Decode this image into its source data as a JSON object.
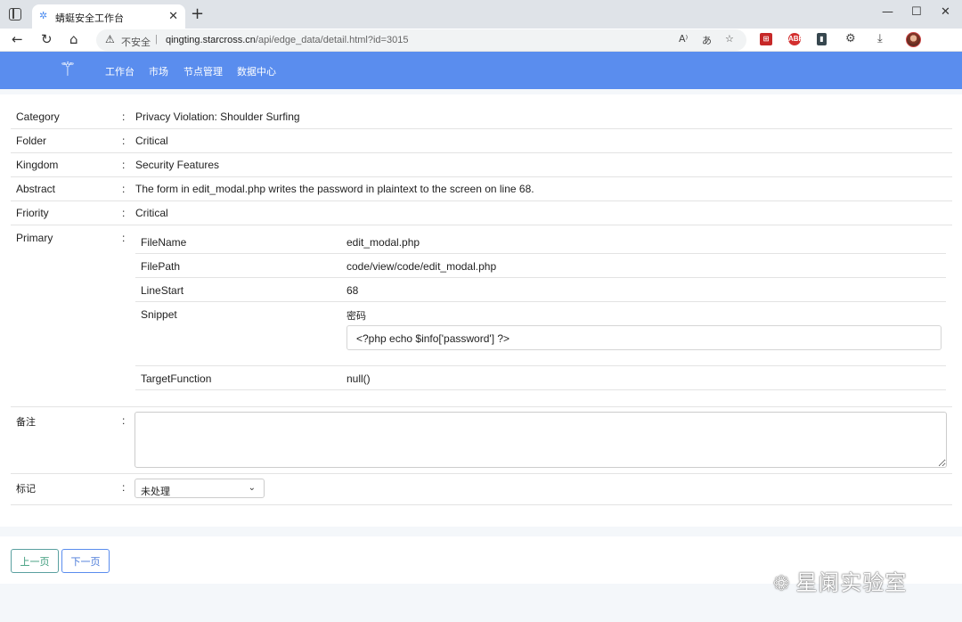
{
  "browser": {
    "tab_title": "蜻蜓安全工作台",
    "insecure_label": "不安全",
    "url_host": "qingting.starcross.cn",
    "url_path": "/api/edge_data/detail.html?id=3015"
  },
  "appnav": {
    "links": [
      "工作台",
      "市场",
      "节点管理",
      "数据中心"
    ]
  },
  "detail": {
    "category": {
      "label": "Category",
      "value": "Privacy Violation: Shoulder Surfing"
    },
    "folder": {
      "label": "Folder",
      "value": "Critical"
    },
    "kingdom": {
      "label": "Kingdom",
      "value": "Security Features"
    },
    "abstract": {
      "label": "Abstract",
      "value": "The form in edit_modal.php writes the password in plaintext to the screen on line 68."
    },
    "friority": {
      "label": "Friority",
      "value": "Critical"
    },
    "primary": {
      "label": "Primary",
      "filename": {
        "label": "FileName",
        "value": "edit_modal.php"
      },
      "filepath": {
        "label": "FilePath",
        "value": "code/view/code/edit_modal.php"
      },
      "linestart": {
        "label": "LineStart",
        "value": "68"
      },
      "snippet": {
        "label": "Snippet",
        "caption": "密码",
        "code": "<?php echo $info['password'] ?>"
      },
      "targetfunction": {
        "label": "TargetFunction",
        "value": "null()"
      }
    },
    "remark": {
      "label": "备注",
      "value": ""
    },
    "mark": {
      "label": "标记",
      "selected": "未处理"
    },
    "colon": ":"
  },
  "pager": {
    "prev": "上一页",
    "next": "下一页"
  },
  "watermark": "星阑实验室",
  "colors": {
    "nav": "#5a8dee",
    "border": "#e3e3e3"
  }
}
